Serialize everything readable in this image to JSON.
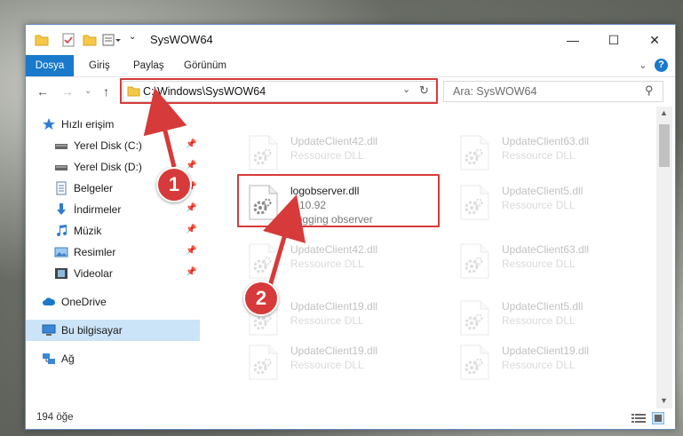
{
  "window": {
    "title": "SysWOW64",
    "minimize": "—",
    "maximize": "☐",
    "close": "✕"
  },
  "ribbon": {
    "tabs": [
      "Dosya",
      "Giriş",
      "Paylaş",
      "Görünüm"
    ],
    "expand": "⌄",
    "help": "?"
  },
  "navigation": {
    "back": "←",
    "forward": "→",
    "recent": "⌄",
    "up": "↑",
    "address": "C:\\Windows\\SysWOW64",
    "address_dropdown": "⌄",
    "refresh": "↻",
    "search_placeholder": "Ara: SysWOW64",
    "search_icon": "⚲"
  },
  "sidebar": {
    "items": [
      {
        "label": "Hızlı erişim",
        "icon": "star-icon",
        "pinned": false
      },
      {
        "label": "Yerel Disk (C:)",
        "icon": "drive-icon",
        "pinned": true
      },
      {
        "label": "Yerel Disk (D:)",
        "icon": "drive-icon",
        "pinned": true
      },
      {
        "label": "Belgeler",
        "icon": "document-icon",
        "pinned": true
      },
      {
        "label": "İndirmeler",
        "icon": "download-icon",
        "pinned": true
      },
      {
        "label": "Müzik",
        "icon": "music-icon",
        "pinned": true
      },
      {
        "label": "Resimler",
        "icon": "pictures-icon",
        "pinned": true
      },
      {
        "label": "Videolar",
        "icon": "video-icon",
        "pinned": true
      },
      {
        "label": "OneDrive",
        "icon": "cloud-icon",
        "pinned": false
      },
      {
        "label": "Bu bilgisayar",
        "icon": "computer-icon",
        "pinned": false,
        "selected": true
      },
      {
        "label": "Ağ",
        "icon": "network-icon",
        "pinned": false
      }
    ],
    "pin_glyph": "📌"
  },
  "files": [
    {
      "name": "UpdateClient42.dll",
      "type": "Ressource DLL",
      "faded": true
    },
    {
      "name": "UpdateClient63.dll",
      "type": "Ressource DLL",
      "faded": true
    },
    {
      "name": "logobserver.dll",
      "version": "9.10.92",
      "type": "Logging observer",
      "faded": false
    },
    {
      "name": "UpdateClient5.dll",
      "type": "Ressource DLL",
      "faded": true
    },
    {
      "name": "UpdateClient42.dll",
      "type": "Ressource DLL",
      "faded": true
    },
    {
      "name": "UpdateClient63.dll",
      "type": "Ressource DLL",
      "faded": true
    },
    {
      "name": "UpdateClient19.dll",
      "type": "Ressource DLL",
      "faded": true
    },
    {
      "name": "UpdateClient5.dll",
      "type": "Ressource DLL",
      "faded": true
    },
    {
      "name": "UpdateClient19.dll",
      "type": "Ressource DLL",
      "faded": true
    },
    {
      "name": "UpdateClient19.dll",
      "type": "Ressource DLL",
      "faded": true
    }
  ],
  "status": {
    "count": "194 öğe"
  },
  "annotations": {
    "step1": "1",
    "step2": "2",
    "color": "#d73a3a"
  },
  "colors": {
    "accent": "#1979ca",
    "selected": "#cce4f7",
    "highlight": "#d73a3a"
  }
}
